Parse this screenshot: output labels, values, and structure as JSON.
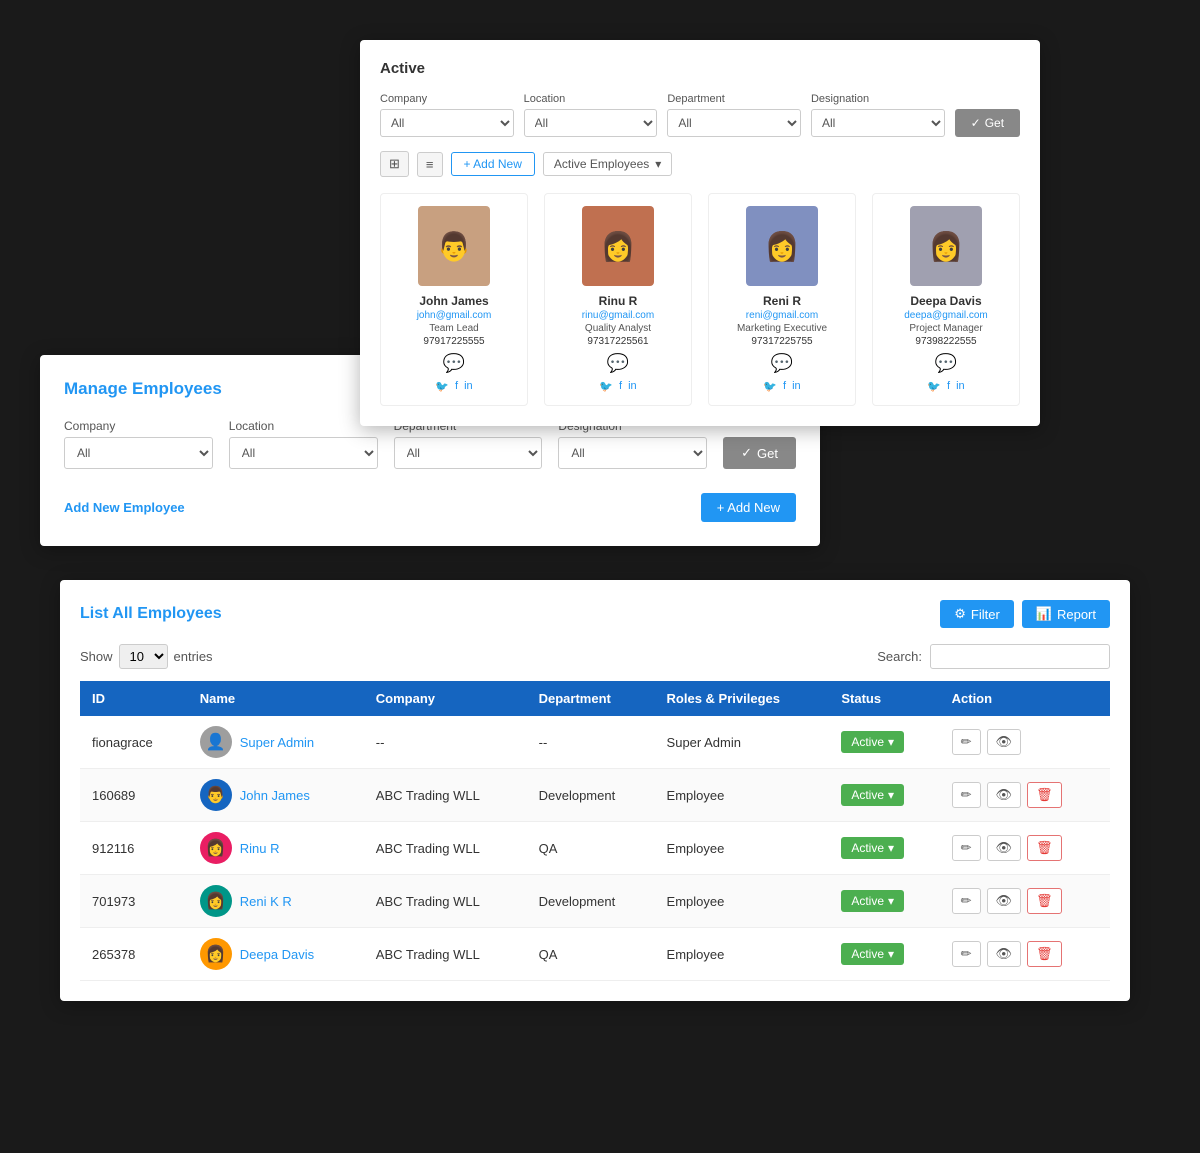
{
  "cardPanel": {
    "title": "Active",
    "filters": {
      "company": {
        "label": "Company",
        "value": "All"
      },
      "location": {
        "label": "Location",
        "value": "All"
      },
      "department": {
        "label": "Department",
        "value": "All"
      },
      "designation": {
        "label": "Designation",
        "value": "All"
      }
    },
    "getBtnLabel": "Get",
    "addNewBtnLabel": "+ Add New",
    "statusDropdownLabel": "Active Employees",
    "employees": [
      {
        "name": "John James",
        "email": "john@gmail.com",
        "role": "Team Lead",
        "phone": "97917225555",
        "avatarEmoji": "👨"
      },
      {
        "name": "Rinu R",
        "email": "rinu@gmail.com",
        "role": "Quality Analyst",
        "phone": "97317225561",
        "avatarEmoji": "👩"
      },
      {
        "name": "Reni R",
        "email": "reni@gmail.com",
        "role": "Marketing Executive",
        "phone": "97317225755",
        "avatarEmoji": "👩"
      },
      {
        "name": "Deepa Davis",
        "email": "deepa@gmail.com",
        "role": "Project Manager",
        "phone": "97398222555",
        "avatarEmoji": "👩"
      }
    ]
  },
  "managePanel": {
    "title": "Manage ",
    "titleHighlight": "Employees",
    "filters": {
      "company": {
        "label": "Company",
        "value": "All"
      },
      "location": {
        "label": "Location",
        "value": "All"
      },
      "department": {
        "label": "Department",
        "value": "All"
      },
      "designation": {
        "label": "Designation",
        "value": "All"
      }
    },
    "getBtnLabel": "Get",
    "addLabel": "Add New",
    "addLabelSuffix": " Employee",
    "addNewBtnLabel": "+ Add New"
  },
  "listPanel": {
    "titlePrefix": "List All ",
    "titleHighlight": "Employees",
    "filterBtnLabel": "Filter",
    "reportBtnLabel": "Report",
    "showLabel": "Show",
    "showValue": "10",
    "entriesLabel": "entries",
    "searchLabel": "Search:",
    "columns": [
      "ID",
      "Name",
      "Company",
      "Department",
      "Roles & Privileges",
      "Status",
      "Action"
    ],
    "rows": [
      {
        "id": "fionagrace",
        "name": "Super Admin",
        "company": "--",
        "department": "--",
        "roles": "Super Admin",
        "status": "Active",
        "avatarEmoji": "👤",
        "avatarClass": "av-gray",
        "hasDelete": false
      },
      {
        "id": "160689",
        "name": "John James",
        "company": "ABC Trading WLL",
        "department": "Development",
        "roles": "Employee",
        "status": "Active",
        "avatarEmoji": "👨",
        "avatarClass": "av-blue",
        "hasDelete": true
      },
      {
        "id": "912116",
        "name": "Rinu R",
        "company": "ABC Trading WLL",
        "department": "QA",
        "roles": "Employee",
        "status": "Active",
        "avatarEmoji": "👩",
        "avatarClass": "av-pink",
        "hasDelete": true
      },
      {
        "id": "701973",
        "name": "Reni K R",
        "company": "ABC Trading WLL",
        "department": "Development",
        "roles": "Employee",
        "status": "Active",
        "avatarEmoji": "👩",
        "avatarClass": "av-teal",
        "hasDelete": true
      },
      {
        "id": "265378",
        "name": "Deepa Davis",
        "company": "ABC Trading WLL",
        "department": "QA",
        "roles": "Employee",
        "status": "Active",
        "avatarEmoji": "👩",
        "avatarClass": "av-orange",
        "hasDelete": true
      }
    ]
  }
}
